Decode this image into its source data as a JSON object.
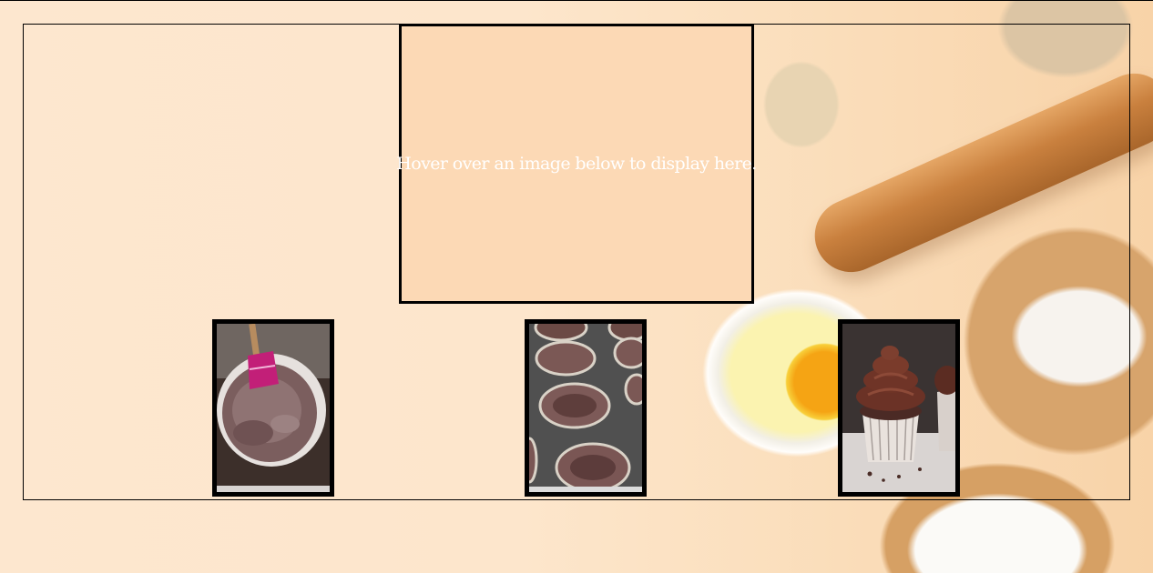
{
  "display": {
    "message": "Hover over an image below to display here."
  },
  "gallery": {
    "items": [
      {
        "icon": "batter-bowl-image"
      },
      {
        "icon": "cupcake-tin-image"
      },
      {
        "icon": "frosted-cupcake-image"
      }
    ]
  }
}
